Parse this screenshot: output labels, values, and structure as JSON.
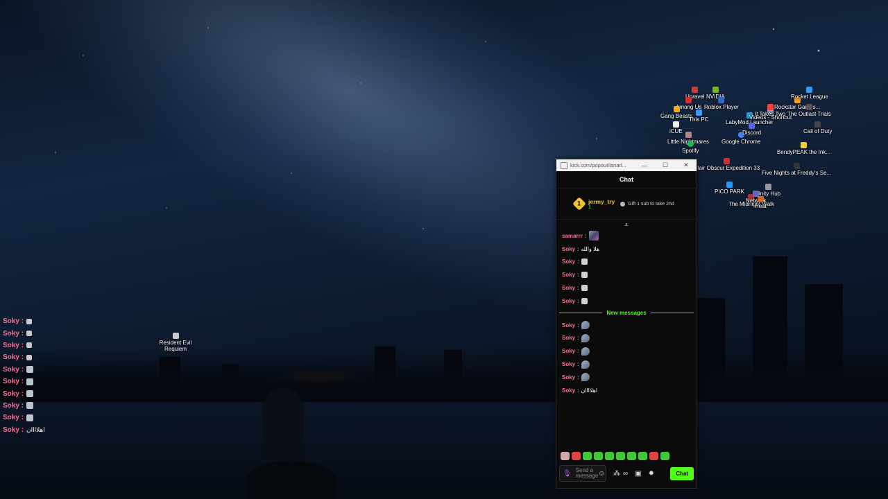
{
  "overlay_chat": [
    {
      "user": "Soky",
      "sep": ":",
      "text": ""
    },
    {
      "user": "Soky",
      "sep": ":",
      "text": ""
    },
    {
      "user": "Soky",
      "sep": ":",
      "text": ""
    },
    {
      "user": "Soky",
      "sep": ":",
      "text": ""
    },
    {
      "user": "Soky",
      "sep": ":",
      "text": ""
    },
    {
      "user": "Soky",
      "sep": ":",
      "text": ""
    },
    {
      "user": "Soky",
      "sep": ":",
      "text": ""
    },
    {
      "user": "Soky",
      "sep": ":",
      "text": ""
    },
    {
      "user": "Soky",
      "sep": ":",
      "text": ""
    },
    {
      "user": "Soky",
      "sep": ":",
      "text": "اهلاااان"
    }
  ],
  "desktop": {
    "resident_evil": "Resident Evil Requiem",
    "icons": [
      "Unravel",
      "NVIDIA",
      "Among Us",
      "Gang Beasts",
      "This PC",
      "Roblox Player",
      "iCUE",
      "LabyMod Launcher",
      "Videos - Shortcut",
      "Rockstar Games...",
      "Rocket League",
      "The Outlast Trials",
      "Little Nightmares",
      "Spotify",
      "Google Chrome",
      "Discord",
      "Call of Duty",
      "BendyPEAK the Ink...",
      "Clair Obscur Expedition 33",
      "Five Nights at Freddy's Se...",
      "PICO PARK",
      "Unity Hub",
      "The Midnight Walk",
      "Network",
      "Heat",
      "It Takes Two"
    ]
  },
  "window": {
    "url": "kick.com/popout/lanarl...",
    "min": "—",
    "max": "☐",
    "close": "✕",
    "header": "Chat",
    "gifter": {
      "rank": "1",
      "name": "jermy_try",
      "count": "1"
    },
    "gift_cta": "Gift 1 sub to take 2nd",
    "messages_before": [
      {
        "user": "samarrr",
        "text": ""
      },
      {
        "user": "Soky",
        "text": "هلا والله"
      },
      {
        "user": "Soky",
        "text": ""
      },
      {
        "user": "Soky",
        "text": ""
      },
      {
        "user": "Soky",
        "text": ""
      },
      {
        "user": "Soky",
        "text": ""
      }
    ],
    "new_messages": "New messages",
    "messages_after": [
      {
        "user": "Soky",
        "text": ""
      },
      {
        "user": "Soky",
        "text": ""
      },
      {
        "user": "Soky",
        "text": ""
      },
      {
        "user": "Soky",
        "text": ""
      },
      {
        "user": "Soky",
        "text": ""
      },
      {
        "user": "Soky",
        "text": "اهلاااان"
      }
    ],
    "input_placeholder": "Send a message",
    "send_label": "Chat"
  },
  "colors": {
    "accent": "#53fc18",
    "username": "#ff6f91",
    "gold": "#f2c230"
  }
}
